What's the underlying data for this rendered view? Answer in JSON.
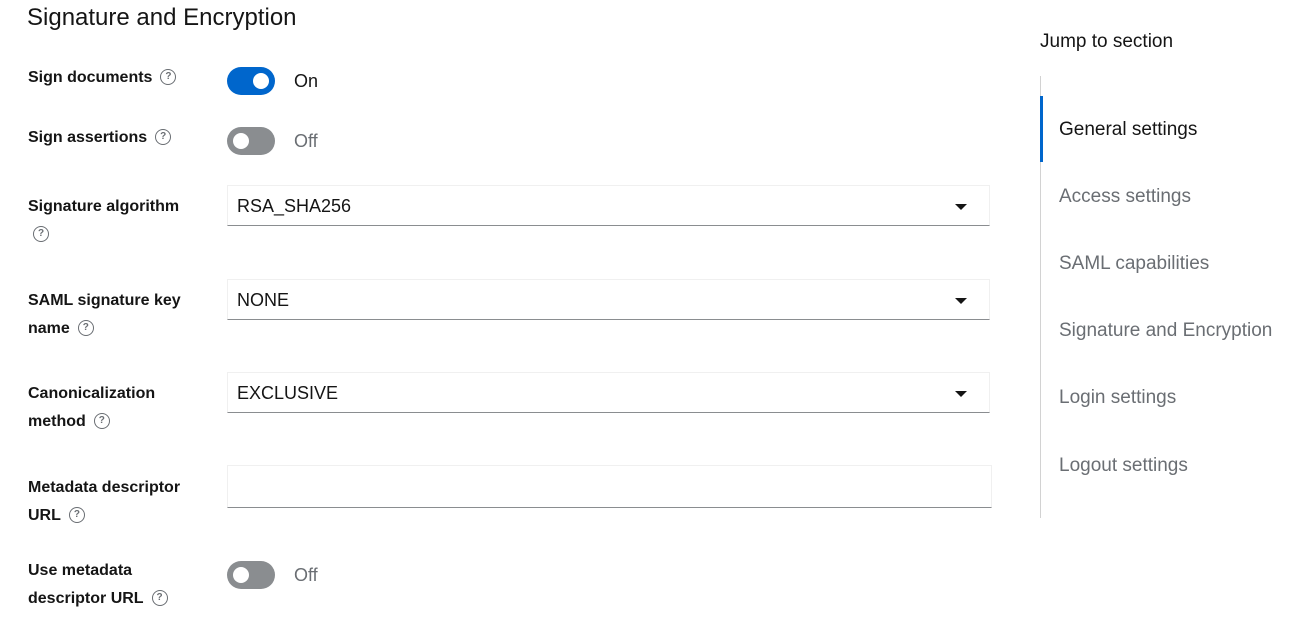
{
  "section": {
    "title": "Signature and Encryption"
  },
  "fields": {
    "sign_documents": {
      "label": "Sign documents",
      "state": "On"
    },
    "sign_assertions": {
      "label": "Sign assertions",
      "state": "Off"
    },
    "signature_algorithm": {
      "label": "Signature algorithm",
      "value": "RSA_SHA256"
    },
    "saml_signature_key_name": {
      "label": "SAML signature key name",
      "value": "NONE"
    },
    "canonicalization_method": {
      "label": "Canonicalization method",
      "value": "EXCLUSIVE"
    },
    "metadata_descriptor_url": {
      "label": "Metadata descriptor URL",
      "value": ""
    },
    "use_metadata_descriptor_url": {
      "label": "Use metadata descriptor URL",
      "state": "Off"
    }
  },
  "help_icon": "question-circle-icon",
  "jump": {
    "title": "Jump to section",
    "items": [
      {
        "label": "General settings",
        "active": true
      },
      {
        "label": "Access settings"
      },
      {
        "label": "SAML capabilities"
      },
      {
        "label": "Signature and Encryption"
      },
      {
        "label": "Login settings"
      },
      {
        "label": "Logout settings"
      }
    ]
  },
  "colors": {
    "accent": "#0066cc",
    "switch_off": "#8a8d90",
    "muted_text": "#6a6e73"
  }
}
